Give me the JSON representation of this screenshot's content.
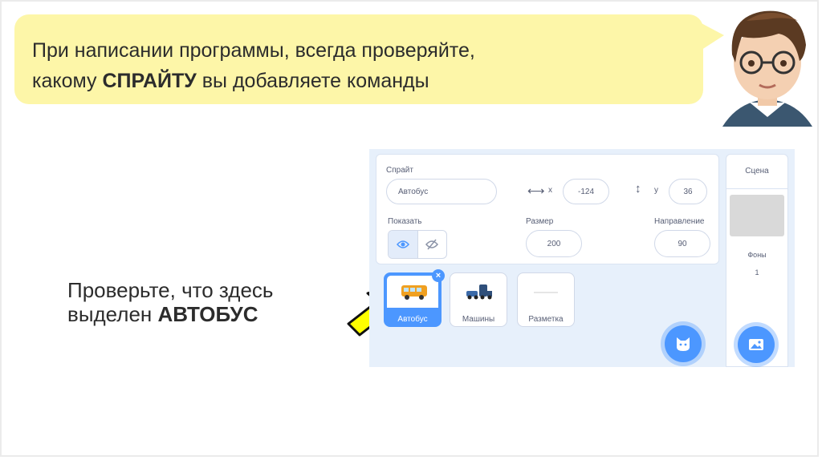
{
  "bubble": {
    "line1": "При написании программы, всегда проверяйте,",
    "line2_before": "какому ",
    "line2_bold": "СПРАЙТУ",
    "line2_after": " вы добавляете команды"
  },
  "note": {
    "line1": "Проверьте, что здесь",
    "line2_before": "выделен ",
    "line2_bold": "АВТОБУС"
  },
  "sprite_panel": {
    "sprite_label": "Спрайт",
    "sprite_name": "Автобус",
    "x_label": "x",
    "x_value": "-124",
    "y_label": "y",
    "y_value": "36",
    "show_label": "Показать",
    "size_label": "Размер",
    "size_value": "200",
    "direction_label": "Направление",
    "direction_value": "90"
  },
  "sprites": [
    {
      "name": "Автобус",
      "selected": true
    },
    {
      "name": "Машины",
      "selected": false
    },
    {
      "name": "Разметка",
      "selected": false
    }
  ],
  "stage": {
    "label": "Сцена",
    "backdrops_label": "Фоны",
    "backdrops_count": "1"
  },
  "colors": {
    "bubble": "#fdf6a8",
    "accent": "#4c97ff",
    "arrow_fill": "#ffff00",
    "panel_bg": "#e7f0fb"
  }
}
